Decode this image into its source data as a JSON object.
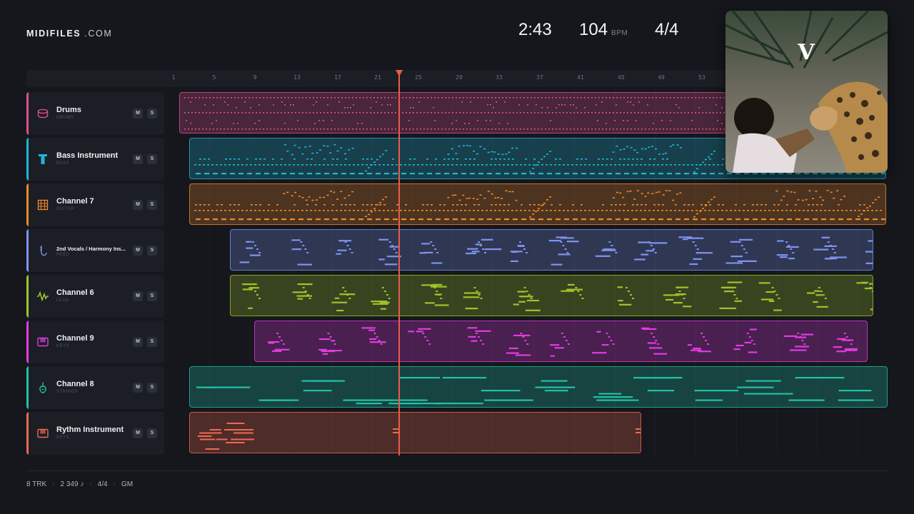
{
  "brand": {
    "name": "MIDIFILES",
    "suffix": ".COM"
  },
  "stats": {
    "time": "2:43",
    "tempo": "104",
    "tempo_unit": "BPM",
    "signature": "4/4"
  },
  "ruler": {
    "bars": [
      "1",
      "5",
      "9",
      "13",
      "17",
      "21",
      "25",
      "29",
      "33",
      "37",
      "41",
      "45",
      "49",
      "53"
    ]
  },
  "tracks": [
    {
      "name": "Drums",
      "sub": "DRUMS",
      "color": "#e0508e",
      "icon": "drum-icon"
    },
    {
      "name": "Bass Instrument",
      "sub": "BASS",
      "color": "#1fb6d3",
      "icon": "bass-icon"
    },
    {
      "name": "Channel 7",
      "sub": "GUITAR",
      "color": "#f0892b",
      "icon": "guitar-icon"
    },
    {
      "name": "2nd Vocals / Harmony Ins...",
      "sub": "REED",
      "color": "#7e93f0",
      "icon": "reed-icon"
    },
    {
      "name": "Channel 6",
      "sub": "LEAD",
      "color": "#9fc42a",
      "icon": "waveform-icon"
    },
    {
      "name": "Channel 9",
      "sub": "KEYS",
      "color": "#e23be0",
      "icon": "piano-icon"
    },
    {
      "name": "Channel 8",
      "sub": "STRINGS",
      "color": "#1fc2a8",
      "icon": "violin-icon"
    },
    {
      "name": "Rythm Instrument",
      "sub": "KEYS",
      "color": "#f0694f",
      "icon": "piano-icon"
    }
  ],
  "buttons": {
    "mute": "M",
    "solo": "S"
  },
  "album_art": {
    "letter": "V"
  },
  "footer": {
    "tracks": "8 TRK",
    "notes": "2 349 ♪",
    "signature": "4/4",
    "format": "GM"
  }
}
